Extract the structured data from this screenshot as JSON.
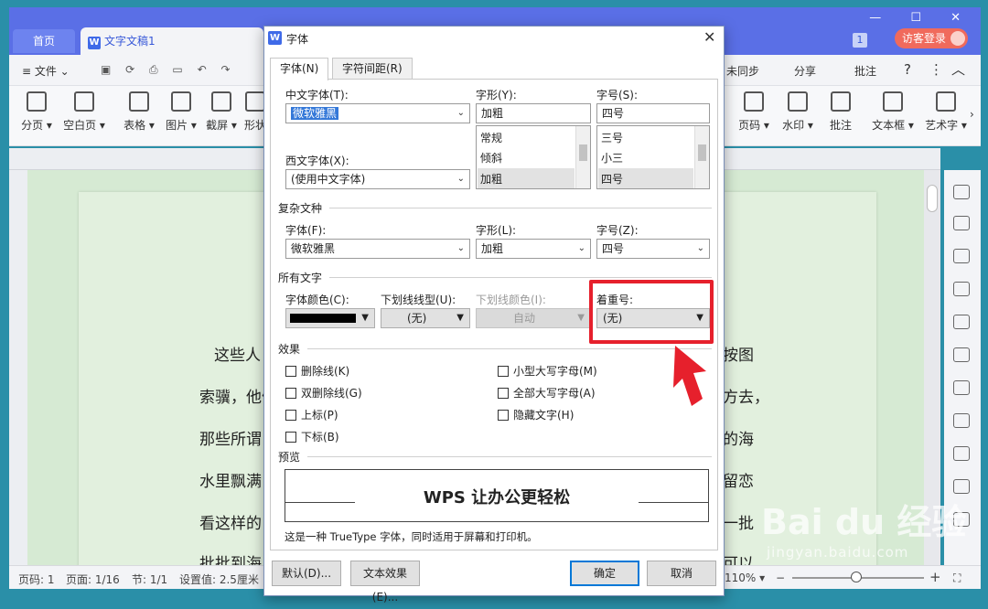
{
  "app": {
    "tab_home": "首页",
    "tab_doc": "文字文稿1",
    "tab_doc_logo": "W",
    "window_controls": "— ☐ ✕",
    "badge": "1",
    "visitor_login": "访客登录"
  },
  "menubar": {
    "file": "≡ 文件 ⌄",
    "sync": "未同步",
    "share": "分享",
    "comment": "批注",
    "help": "?",
    "more": "⋮",
    "collapse": "︿"
  },
  "ribbon": {
    "items": [
      {
        "label": "分页 ▾"
      },
      {
        "label": "空白页 ▾"
      },
      {
        "label": "表格 ▾"
      },
      {
        "label": "图片 ▾"
      },
      {
        "label": "截屏 ▾"
      },
      {
        "label": "形状"
      },
      {
        "label": "页码 ▾"
      },
      {
        "label": "水印 ▾"
      },
      {
        "label": "批注"
      },
      {
        "label": "文本框 ▾"
      },
      {
        "label": "艺术字 ▾"
      }
    ],
    "more": "›"
  },
  "document": {
    "left_lines": [
      "这些人",
      "索骥，他们",
      "那些所谓",
      "水里飘满",
      "看这样的",
      "批批到海"
    ],
    "right_lines": [
      "按图",
      "方去，",
      "的海",
      "留恋",
      "一批",
      "可以"
    ]
  },
  "status": {
    "page_num": "页码: 1",
    "page_of": "页面: 1/16",
    "section": "节: 1/1",
    "setting": "设置值: 2.5厘米",
    "zoom": "110% ▾"
  },
  "dialog": {
    "title": "字体",
    "close": "✕",
    "tabs": [
      "字体(N)",
      "字符间距(R)"
    ],
    "cn_font_label": "中文字体(T):",
    "cn_font_value": "微软雅黑",
    "style_label": "字形(Y):",
    "style_value": "加粗",
    "style_list": [
      "常规",
      "倾斜",
      "加粗"
    ],
    "size_label": "字号(S):",
    "size_value": "四号",
    "size_list": [
      "三号",
      "小三",
      "四号"
    ],
    "west_font_label": "西文字体(X):",
    "west_font_value": "(使用中文字体)",
    "complex_group": "复杂文种",
    "complex_font_label": "字体(F):",
    "complex_font_value": "微软雅黑",
    "complex_style_label": "字形(L):",
    "complex_style_value": "加粗",
    "complex_size_label": "字号(Z):",
    "complex_size_value": "四号",
    "all_text_group": "所有文字",
    "font_color_label": "字体颜色(C):",
    "font_color_value": "#000000",
    "underline_type_label": "下划线线型(U):",
    "underline_type_value": "(无)",
    "underline_color_label": "下划线颜色(I):",
    "underline_color_value": "自动",
    "emphasis_label": "着重号:",
    "emphasis_value": "(无)",
    "effects_group": "效果",
    "effects": {
      "strikethrough": "删除线(K)",
      "double_strike": "双删除线(G)",
      "superscript": "上标(P)",
      "subscript": "下标(B)",
      "small_caps": "小型大写字母(M)",
      "all_caps": "全部大写字母(A)",
      "hidden": "隐藏文字(H)"
    },
    "preview_group": "预览",
    "preview_text": "WPS 让办公更轻松",
    "truetype_note": "这是一种 TrueType 字体，同时适用于屏幕和打印机。",
    "btn_default": "默认(D)...",
    "btn_text_effect": "文本效果(E)...",
    "btn_ok": "确定",
    "btn_cancel": "取消"
  },
  "watermark": {
    "brand": "Bai du 经验",
    "url": "jingyan.baidu.com"
  },
  "colors": {
    "accent_red": "#e6202c",
    "title_blue": "#5a6fe6"
  }
}
